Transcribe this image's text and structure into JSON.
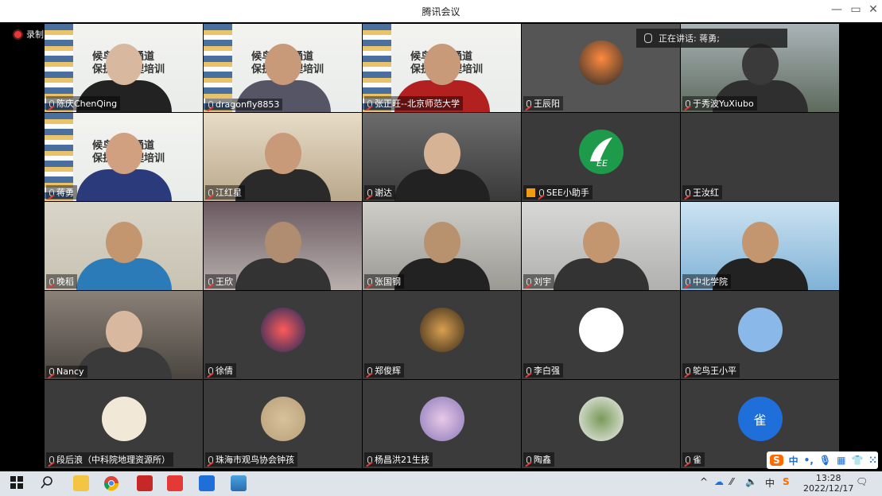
{
  "window": {
    "title": "腾讯会议",
    "minimize": "—",
    "restore": "▭",
    "close": "✕"
  },
  "recording": {
    "label": "录制中"
  },
  "speaking": {
    "label": "正在讲话: 蒋勇;"
  },
  "colors": {
    "stage": "#000000",
    "label_bg": "rgba(0,0,0,0.45)",
    "muted": "#e53935",
    "taskbar": "#dfe4ea"
  },
  "participants": [
    {
      "name": "陈庆ChenQing",
      "type": "banner",
      "banner": [
        "候鸟迁飞通道",
        "保护与管理培训"
      ]
    },
    {
      "name": "dragonfly8853",
      "type": "banner",
      "banner": [
        "候鸟迁飞通道",
        "保护与管理培训"
      ]
    },
    {
      "name": "张正旺--北京师范大学",
      "type": "banner",
      "banner": [
        "候鸟迁飞通道",
        "保护与管理培训"
      ]
    },
    {
      "name": "王辰阳",
      "type": "avatar"
    },
    {
      "name": "于秀波YuXiubo",
      "type": "video"
    },
    {
      "name": "蒋勇",
      "type": "banner",
      "banner": [
        "候鸟迁飞通道",
        "保护与管理培训"
      ]
    },
    {
      "name": "江红星",
      "type": "video"
    },
    {
      "name": "谢达",
      "type": "video"
    },
    {
      "name": "SEE小助手",
      "type": "logo"
    },
    {
      "name": "王汝红",
      "type": "blank"
    },
    {
      "name": "晚稻",
      "type": "video"
    },
    {
      "name": "王欣",
      "type": "video"
    },
    {
      "name": "张国钢",
      "type": "video"
    },
    {
      "name": "刘宇",
      "type": "video"
    },
    {
      "name": "中北学院",
      "type": "video"
    },
    {
      "name": "Nancy",
      "type": "video"
    },
    {
      "name": "徐倩",
      "type": "avatar"
    },
    {
      "name": "郑俊辉",
      "type": "avatar"
    },
    {
      "name": "李白强",
      "type": "avatar"
    },
    {
      "name": "鸵鸟王小平",
      "type": "avatar"
    },
    {
      "name": "段后浪（中科院地理资源所）",
      "type": "avatar"
    },
    {
      "name": "珠海市观鸟协会钟孩",
      "type": "avatar"
    },
    {
      "name": "杨昌洪21生技",
      "type": "avatar"
    },
    {
      "name": "陶鑫",
      "type": "avatar"
    },
    {
      "name": "雀",
      "type": "letter",
      "letter": "雀"
    }
  ],
  "taskbar": {
    "apps": [
      "windows-start",
      "search",
      "file-explorer",
      "chrome",
      "app-red",
      "app-red-2",
      "tencent-meeting",
      "photos"
    ],
    "tray": {
      "ime_lang": "中",
      "time": "13:28",
      "date": "2022/12/17"
    }
  },
  "ime_toolbar": {
    "logo": "S",
    "lang": "中"
  }
}
